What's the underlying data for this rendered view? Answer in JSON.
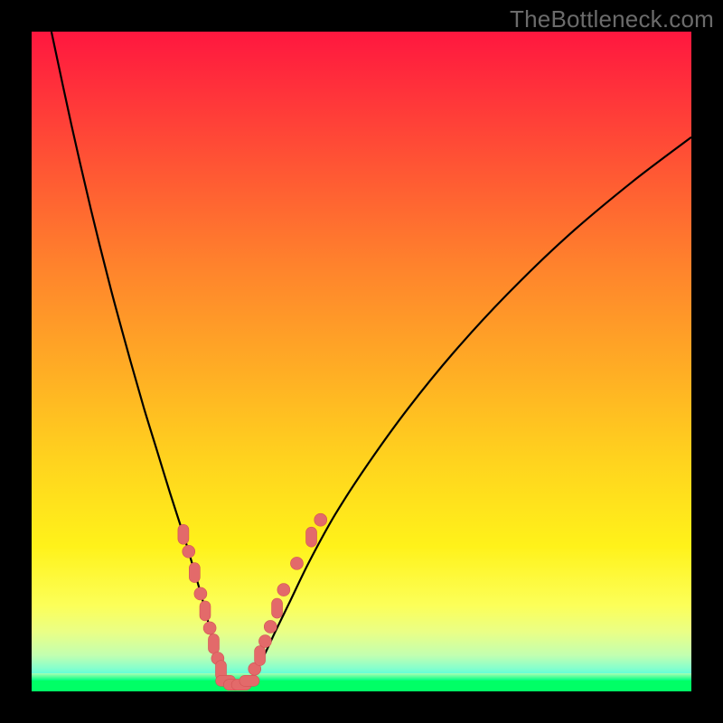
{
  "watermark": "TheBottleneck.com",
  "colors": {
    "frame": "#000000",
    "curve_stroke": "#000000",
    "marker_fill": "#e36a6a",
    "marker_stroke": "#d35254"
  },
  "chart_data": {
    "type": "line",
    "title": "",
    "xlabel": "",
    "ylabel": "",
    "xlim": [
      0,
      100
    ],
    "ylim": [
      0,
      100
    ],
    "grid": false,
    "legend": false,
    "series": [
      {
        "name": "left-branch",
        "x": [
          3,
          6,
          9,
          12,
          15,
          17,
          19,
          21,
          23,
          24.5,
          26,
          27,
          27.8,
          28.5,
          29
        ],
        "y": [
          100,
          86,
          73,
          61,
          50,
          43,
          36.5,
          30,
          23.8,
          18.8,
          13.5,
          9.5,
          6.2,
          3.5,
          1.5
        ]
      },
      {
        "name": "right-branch",
        "x": [
          33,
          34,
          35.5,
          37,
          39,
          42,
          46,
          51,
          57,
          64,
          72,
          81,
          91,
          100
        ],
        "y": [
          1.5,
          3.2,
          6.0,
          9.2,
          13.3,
          19.5,
          26.8,
          34.5,
          42.8,
          51.4,
          60.1,
          68.8,
          77.2,
          84.0
        ]
      },
      {
        "name": "valley-floor",
        "x": [
          29,
          30,
          31,
          32,
          33
        ],
        "y": [
          1.2,
          0.9,
          0.8,
          0.9,
          1.2
        ]
      }
    ],
    "markers": [
      {
        "x": 23.0,
        "y": 23.8,
        "shape": "pill-v"
      },
      {
        "x": 23.8,
        "y": 21.2,
        "shape": "round"
      },
      {
        "x": 24.7,
        "y": 18.0,
        "shape": "pill-v"
      },
      {
        "x": 25.6,
        "y": 14.8,
        "shape": "round"
      },
      {
        "x": 26.3,
        "y": 12.2,
        "shape": "pill-v"
      },
      {
        "x": 27.0,
        "y": 9.6,
        "shape": "round"
      },
      {
        "x": 27.6,
        "y": 7.2,
        "shape": "pill-v"
      },
      {
        "x": 28.2,
        "y": 5.0,
        "shape": "round"
      },
      {
        "x": 28.7,
        "y": 3.2,
        "shape": "pill-v"
      },
      {
        "x": 29.4,
        "y": 1.6,
        "shape": "pill-h"
      },
      {
        "x": 30.6,
        "y": 1.0,
        "shape": "pill-h"
      },
      {
        "x": 31.8,
        "y": 1.0,
        "shape": "pill-h"
      },
      {
        "x": 33.0,
        "y": 1.6,
        "shape": "pill-h"
      },
      {
        "x": 33.8,
        "y": 3.4,
        "shape": "round"
      },
      {
        "x": 34.6,
        "y": 5.4,
        "shape": "pill-v"
      },
      {
        "x": 35.4,
        "y": 7.6,
        "shape": "round"
      },
      {
        "x": 36.2,
        "y": 9.8,
        "shape": "round"
      },
      {
        "x": 37.2,
        "y": 12.6,
        "shape": "pill-v"
      },
      {
        "x": 38.2,
        "y": 15.4,
        "shape": "round"
      },
      {
        "x": 40.2,
        "y": 19.4,
        "shape": "round"
      },
      {
        "x": 42.4,
        "y": 23.4,
        "shape": "pill-v"
      },
      {
        "x": 43.8,
        "y": 26.0,
        "shape": "round"
      }
    ]
  }
}
